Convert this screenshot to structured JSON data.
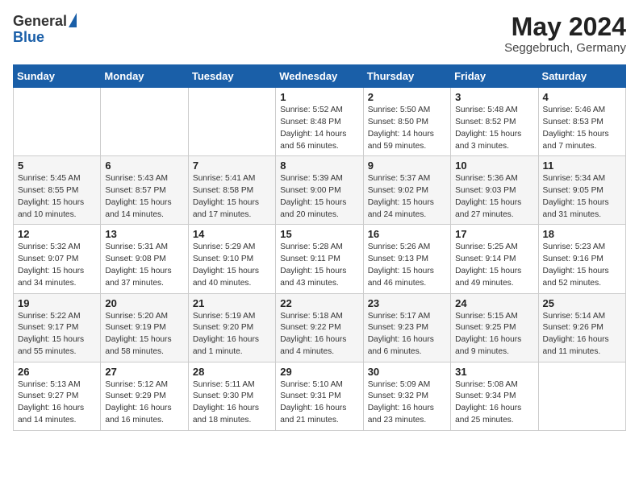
{
  "header": {
    "logo_general": "General",
    "logo_blue": "Blue",
    "month_year": "May 2024",
    "location": "Seggebruch, Germany"
  },
  "weekdays": [
    "Sunday",
    "Monday",
    "Tuesday",
    "Wednesday",
    "Thursday",
    "Friday",
    "Saturday"
  ],
  "weeks": [
    [
      {
        "day": "",
        "info": ""
      },
      {
        "day": "",
        "info": ""
      },
      {
        "day": "",
        "info": ""
      },
      {
        "day": "1",
        "info": "Sunrise: 5:52 AM\nSunset: 8:48 PM\nDaylight: 14 hours\nand 56 minutes."
      },
      {
        "day": "2",
        "info": "Sunrise: 5:50 AM\nSunset: 8:50 PM\nDaylight: 14 hours\nand 59 minutes."
      },
      {
        "day": "3",
        "info": "Sunrise: 5:48 AM\nSunset: 8:52 PM\nDaylight: 15 hours\nand 3 minutes."
      },
      {
        "day": "4",
        "info": "Sunrise: 5:46 AM\nSunset: 8:53 PM\nDaylight: 15 hours\nand 7 minutes."
      }
    ],
    [
      {
        "day": "5",
        "info": "Sunrise: 5:45 AM\nSunset: 8:55 PM\nDaylight: 15 hours\nand 10 minutes."
      },
      {
        "day": "6",
        "info": "Sunrise: 5:43 AM\nSunset: 8:57 PM\nDaylight: 15 hours\nand 14 minutes."
      },
      {
        "day": "7",
        "info": "Sunrise: 5:41 AM\nSunset: 8:58 PM\nDaylight: 15 hours\nand 17 minutes."
      },
      {
        "day": "8",
        "info": "Sunrise: 5:39 AM\nSunset: 9:00 PM\nDaylight: 15 hours\nand 20 minutes."
      },
      {
        "day": "9",
        "info": "Sunrise: 5:37 AM\nSunset: 9:02 PM\nDaylight: 15 hours\nand 24 minutes."
      },
      {
        "day": "10",
        "info": "Sunrise: 5:36 AM\nSunset: 9:03 PM\nDaylight: 15 hours\nand 27 minutes."
      },
      {
        "day": "11",
        "info": "Sunrise: 5:34 AM\nSunset: 9:05 PM\nDaylight: 15 hours\nand 31 minutes."
      }
    ],
    [
      {
        "day": "12",
        "info": "Sunrise: 5:32 AM\nSunset: 9:07 PM\nDaylight: 15 hours\nand 34 minutes."
      },
      {
        "day": "13",
        "info": "Sunrise: 5:31 AM\nSunset: 9:08 PM\nDaylight: 15 hours\nand 37 minutes."
      },
      {
        "day": "14",
        "info": "Sunrise: 5:29 AM\nSunset: 9:10 PM\nDaylight: 15 hours\nand 40 minutes."
      },
      {
        "day": "15",
        "info": "Sunrise: 5:28 AM\nSunset: 9:11 PM\nDaylight: 15 hours\nand 43 minutes."
      },
      {
        "day": "16",
        "info": "Sunrise: 5:26 AM\nSunset: 9:13 PM\nDaylight: 15 hours\nand 46 minutes."
      },
      {
        "day": "17",
        "info": "Sunrise: 5:25 AM\nSunset: 9:14 PM\nDaylight: 15 hours\nand 49 minutes."
      },
      {
        "day": "18",
        "info": "Sunrise: 5:23 AM\nSunset: 9:16 PM\nDaylight: 15 hours\nand 52 minutes."
      }
    ],
    [
      {
        "day": "19",
        "info": "Sunrise: 5:22 AM\nSunset: 9:17 PM\nDaylight: 15 hours\nand 55 minutes."
      },
      {
        "day": "20",
        "info": "Sunrise: 5:20 AM\nSunset: 9:19 PM\nDaylight: 15 hours\nand 58 minutes."
      },
      {
        "day": "21",
        "info": "Sunrise: 5:19 AM\nSunset: 9:20 PM\nDaylight: 16 hours\nand 1 minute."
      },
      {
        "day": "22",
        "info": "Sunrise: 5:18 AM\nSunset: 9:22 PM\nDaylight: 16 hours\nand 4 minutes."
      },
      {
        "day": "23",
        "info": "Sunrise: 5:17 AM\nSunset: 9:23 PM\nDaylight: 16 hours\nand 6 minutes."
      },
      {
        "day": "24",
        "info": "Sunrise: 5:15 AM\nSunset: 9:25 PM\nDaylight: 16 hours\nand 9 minutes."
      },
      {
        "day": "25",
        "info": "Sunrise: 5:14 AM\nSunset: 9:26 PM\nDaylight: 16 hours\nand 11 minutes."
      }
    ],
    [
      {
        "day": "26",
        "info": "Sunrise: 5:13 AM\nSunset: 9:27 PM\nDaylight: 16 hours\nand 14 minutes."
      },
      {
        "day": "27",
        "info": "Sunrise: 5:12 AM\nSunset: 9:29 PM\nDaylight: 16 hours\nand 16 minutes."
      },
      {
        "day": "28",
        "info": "Sunrise: 5:11 AM\nSunset: 9:30 PM\nDaylight: 16 hours\nand 18 minutes."
      },
      {
        "day": "29",
        "info": "Sunrise: 5:10 AM\nSunset: 9:31 PM\nDaylight: 16 hours\nand 21 minutes."
      },
      {
        "day": "30",
        "info": "Sunrise: 5:09 AM\nSunset: 9:32 PM\nDaylight: 16 hours\nand 23 minutes."
      },
      {
        "day": "31",
        "info": "Sunrise: 5:08 AM\nSunset: 9:34 PM\nDaylight: 16 hours\nand 25 minutes."
      },
      {
        "day": "",
        "info": ""
      }
    ]
  ]
}
